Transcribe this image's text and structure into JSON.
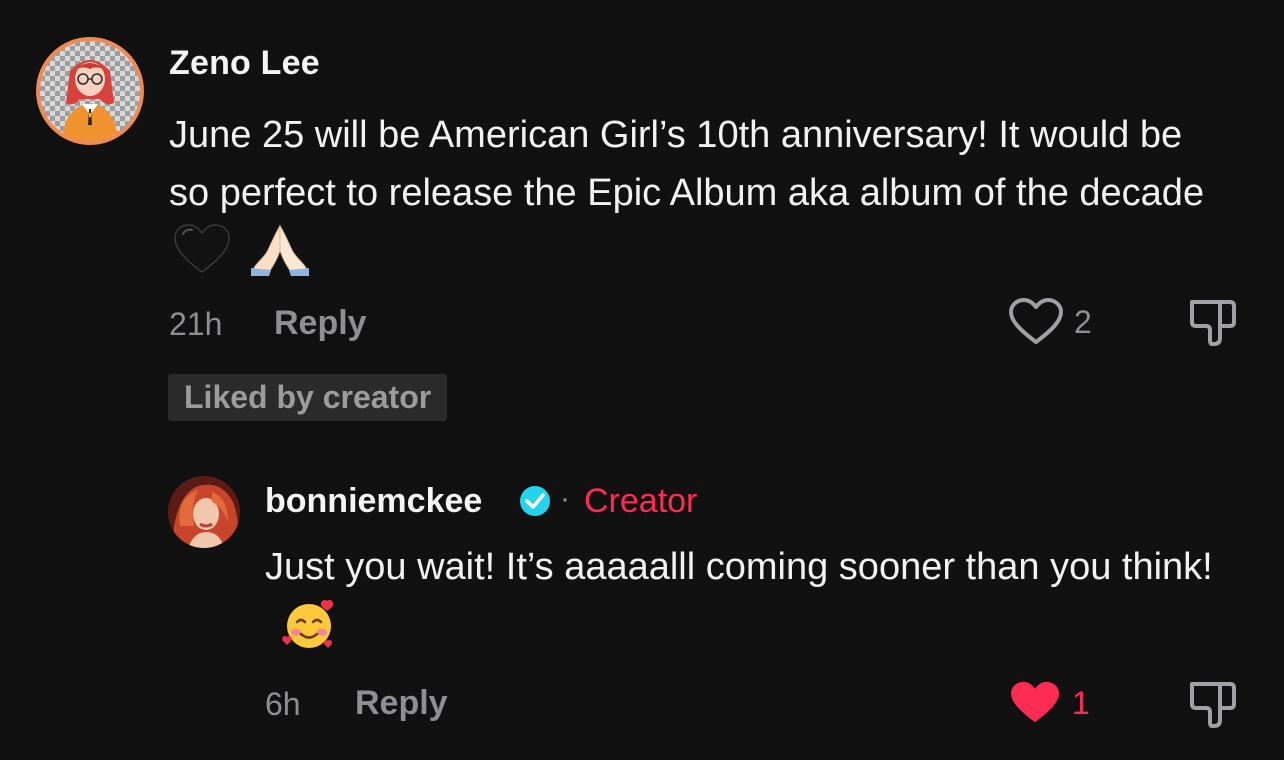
{
  "comment": {
    "username": "Zeno Lee",
    "text": "June 25 will be American Girl’s 10th anniversary! It would be so perfect to release the Epic Album aka album of the decade",
    "emojis": [
      "black-heart",
      "folded-hands"
    ],
    "time": "21h",
    "reply_label": "Reply",
    "like_count": "2",
    "liked": false,
    "liked_by_creator": "Liked by creator"
  },
  "reply": {
    "username": "bonniemckee",
    "verified": true,
    "separator": "·",
    "creator_label": "Creator",
    "text": "Just you wait! It’s aaaaalll coming sooner than you think!",
    "emoji": "smiling-face-with-hearts",
    "time": "6h",
    "reply_label": "Reply",
    "like_count": "1",
    "liked": true
  },
  "colors": {
    "background": "#111111",
    "text": "#f2f2f2",
    "muted": "#8e8e93",
    "creator_accent": "#fe2c55",
    "liked_heart": "#fe2c55",
    "verified": "#20d5ec",
    "liked_badge_bg": "#2b2b2b"
  }
}
